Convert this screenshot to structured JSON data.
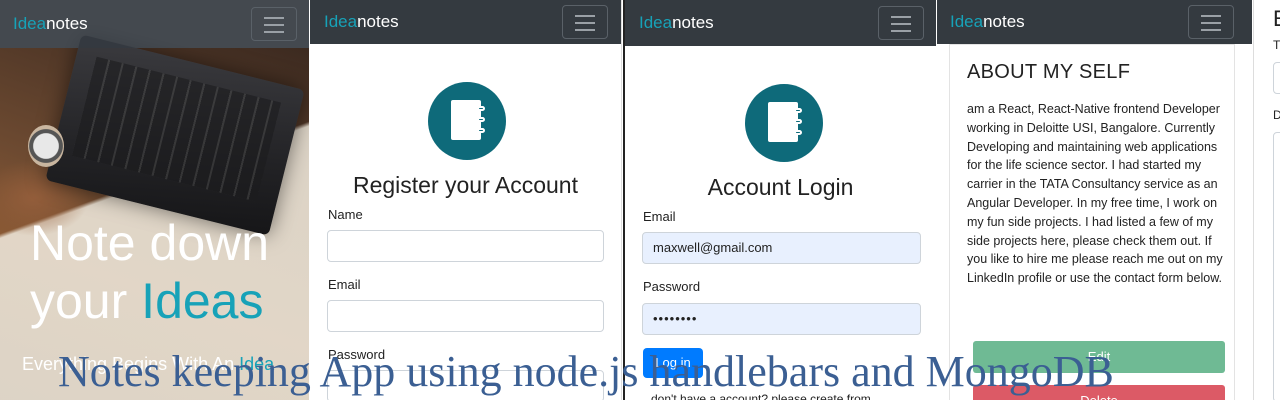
{
  "brand": {
    "accent": "Idea",
    "rest": "notes"
  },
  "colors": {
    "navbar": "#343a40",
    "accent": "#17a2b8",
    "logo": "#0e6a7a",
    "primary": "#007bff",
    "success": "#6fba94",
    "danger": "#dc5a66",
    "caption": "#3b5f93"
  },
  "icons": {
    "menu": "hamburger-icon",
    "logo": "notebook-icon"
  },
  "hero": {
    "title_line1": "Note down",
    "title_line2_plain": "your",
    "title_line2_accent": "Ideas",
    "subtitle_plain": "Everything Begins With An",
    "subtitle_accent": "Idea"
  },
  "register": {
    "title": "Register your Account",
    "name_label": "Name",
    "email_label": "Email",
    "password_label": "Password"
  },
  "login": {
    "title": "Account Login",
    "email_label": "Email",
    "email_value": "maxwell@gmail.com",
    "password_label": "Password",
    "password_value": "••••••••",
    "button": "Log in",
    "footer_text": "don't have a account? please create from"
  },
  "about": {
    "title": "ABOUT MY SELF",
    "text": "am a React, React-Native frontend Developer working in Deloitte USI, Bangalore. Currently Developing and maintaining web applications for the life science sector. I had started my carrier in the TATA Consultancy service as an Angular Developer. In my free time, I work on my fun side projects. I had listed a few of my side projects here, please check them out. If you like to hire me please reach me out on my LinkedIn profile or use the contact form below.",
    "edit_button": "Edit",
    "delete_button": "Delete"
  },
  "partial": {
    "heading": "E",
    "label1": "T",
    "label2": "D"
  },
  "caption": "Notes keeping App using node.js handlebars and MongoDB"
}
